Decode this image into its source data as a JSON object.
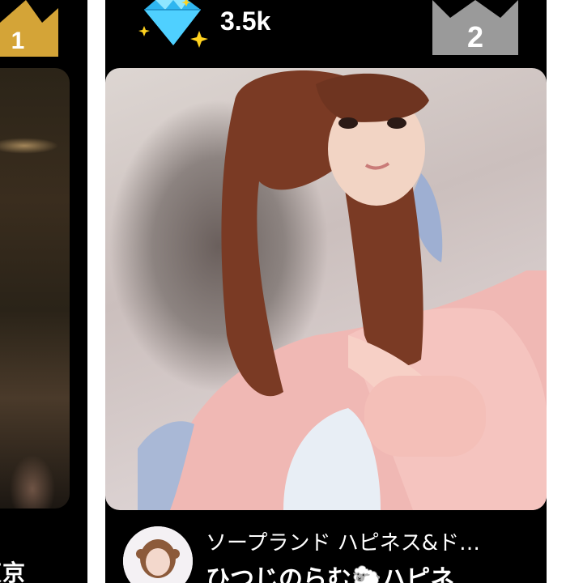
{
  "left_card": {
    "rank": "1",
    "name_partial": "東京",
    "crown_color": "#d4a437"
  },
  "main_card": {
    "score": "3.5k",
    "rank": "2",
    "crown_color": "#9a9a9a",
    "icons": {
      "score_icon": "diamond-icon",
      "rank_icon": "crown-icon"
    },
    "store_name": "ソープランド ハピネス&ド…",
    "girl_name": "ひつじのらむ🐑ハピネ"
  }
}
